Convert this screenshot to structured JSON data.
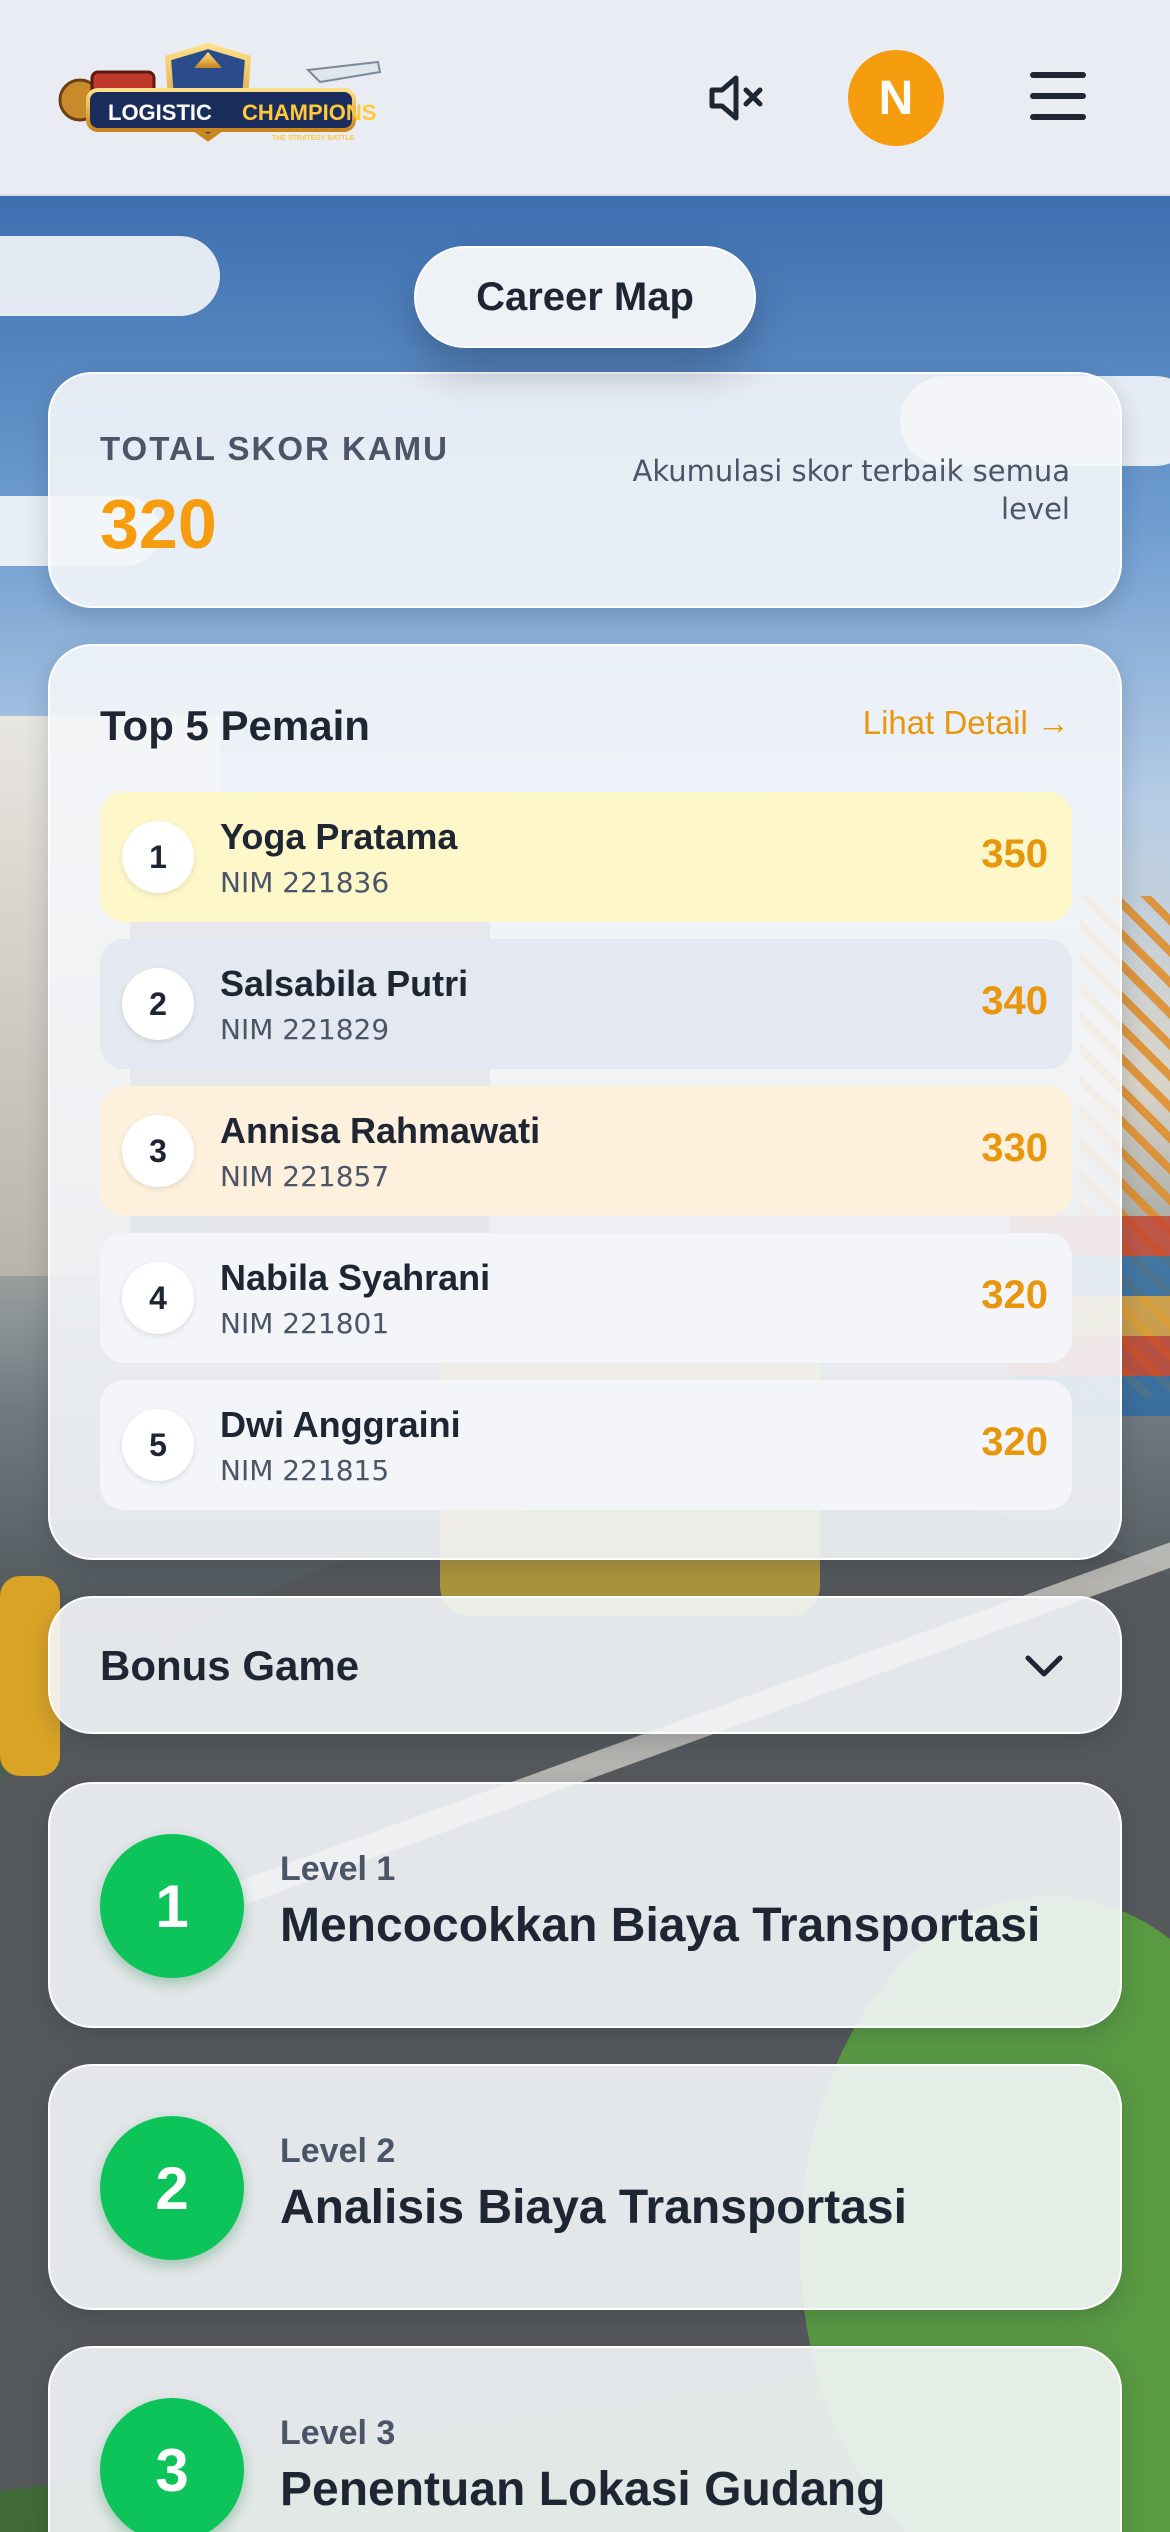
{
  "header": {
    "logo_text_left": "LOGISTIC",
    "logo_text_right": "CHAMPIONS",
    "logo_tagline": "THE STRATEGY BATTLE",
    "mute_icon": "volume-mute-icon",
    "avatar_initial": "N",
    "menu_icon": "hamburger-menu-icon"
  },
  "page": {
    "title": "Career Map"
  },
  "score": {
    "label": "TOTAL SKOR KAMU",
    "value": "320",
    "note": "Akumulasi skor terbaik semua level"
  },
  "leaderboard": {
    "title": "Top 5 Pemain",
    "detail_link": "Lihat Detail →",
    "rows": [
      {
        "rank": "1",
        "name": "Yoga Pratama",
        "nim": "NIM 221836",
        "score": "350",
        "bg": "#fdf7c9"
      },
      {
        "rank": "2",
        "name": "Salsabila Putri",
        "nim": "NIM 221829",
        "score": "340",
        "bg": "#e4e8f0"
      },
      {
        "rank": "3",
        "name": "Annisa Rahmawati",
        "nim": "NIM 221857",
        "score": "330",
        "bg": "#fdf0dc"
      },
      {
        "rank": "4",
        "name": "Nabila Syahrani",
        "nim": "NIM 221801",
        "score": "320",
        "bg": "#f3f5f8"
      },
      {
        "rank": "5",
        "name": "Dwi Anggraini",
        "nim": "NIM 221815",
        "score": "320",
        "bg": "#f3f5f8"
      }
    ]
  },
  "bonus": {
    "title": "Bonus Game",
    "icon": "chevron-down-icon"
  },
  "levels": [
    {
      "number": "1",
      "label": "Level 1",
      "name": "Mencocokkan Biaya Transportasi"
    },
    {
      "number": "2",
      "label": "Level 2",
      "name": "Analisis Biaya Transportasi"
    },
    {
      "number": "3",
      "label": "Level 3",
      "name": "Penentuan Lokasi Gudang"
    }
  ],
  "colors": {
    "accent_orange": "#f59c0f",
    "level_green": "#0cc45a",
    "text_dark": "#1e2533"
  }
}
